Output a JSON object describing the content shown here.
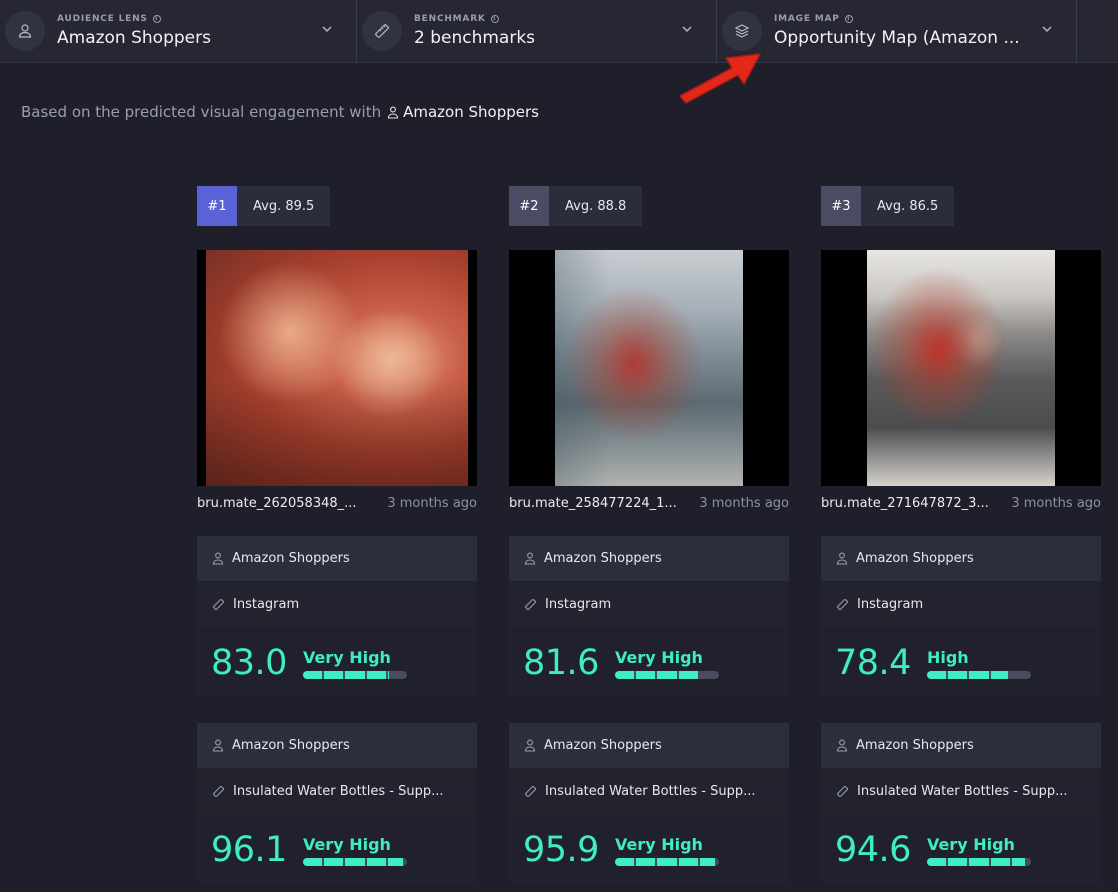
{
  "topbar": [
    {
      "label": "AUDIENCE LENS",
      "value": "Amazon Shoppers",
      "icon": "person-icon"
    },
    {
      "label": "BENCHMARK",
      "value": "2 benchmarks",
      "icon": "ruler-icon"
    },
    {
      "label": "IMAGE MAP",
      "value": "Opportunity Map (Amazon ...",
      "icon": "layers-icon"
    }
  ],
  "subtitle": {
    "prefix": "Based on the predicted visual engagement with",
    "lens": "Amazon Shoppers"
  },
  "results": [
    {
      "rank": "#1",
      "avg": "Avg. 89.5",
      "filename": "bru.mate_262058348_...",
      "age": "3 months ago",
      "cards": [
        {
          "audience": "Amazon Shoppers",
          "benchmark": "Instagram",
          "score": "83.0",
          "level": "Very High",
          "fraction": 0.83
        },
        {
          "audience": "Amazon Shoppers",
          "benchmark": "Insulated Water Bottles - Supp...",
          "score": "96.1",
          "level": "Very High",
          "fraction": 0.961
        }
      ]
    },
    {
      "rank": "#2",
      "avg": "Avg. 88.8",
      "filename": "bru.mate_258477224_1...",
      "age": "3 months ago",
      "cards": [
        {
          "audience": "Amazon Shoppers",
          "benchmark": "Instagram",
          "score": "81.6",
          "level": "Very High",
          "fraction": 0.816
        },
        {
          "audience": "Amazon Shoppers",
          "benchmark": "Insulated Water Bottles - Supp...",
          "score": "95.9",
          "level": "Very High",
          "fraction": 0.959
        }
      ]
    },
    {
      "rank": "#3",
      "avg": "Avg. 86.5",
      "filename": "bru.mate_271647872_3...",
      "age": "3 months ago",
      "cards": [
        {
          "audience": "Amazon Shoppers",
          "benchmark": "Instagram",
          "score": "78.4",
          "level": "High",
          "fraction": 0.784
        },
        {
          "audience": "Amazon Shoppers",
          "benchmark": "Insulated Water Bottles - Supp...",
          "score": "94.6",
          "level": "Very High",
          "fraction": 0.946
        }
      ]
    }
  ],
  "colors": {
    "accent": "#3eecc6",
    "rank_first": "#5a62d6",
    "rank_other": "#4b4c63",
    "arrow": "#e2281a"
  }
}
